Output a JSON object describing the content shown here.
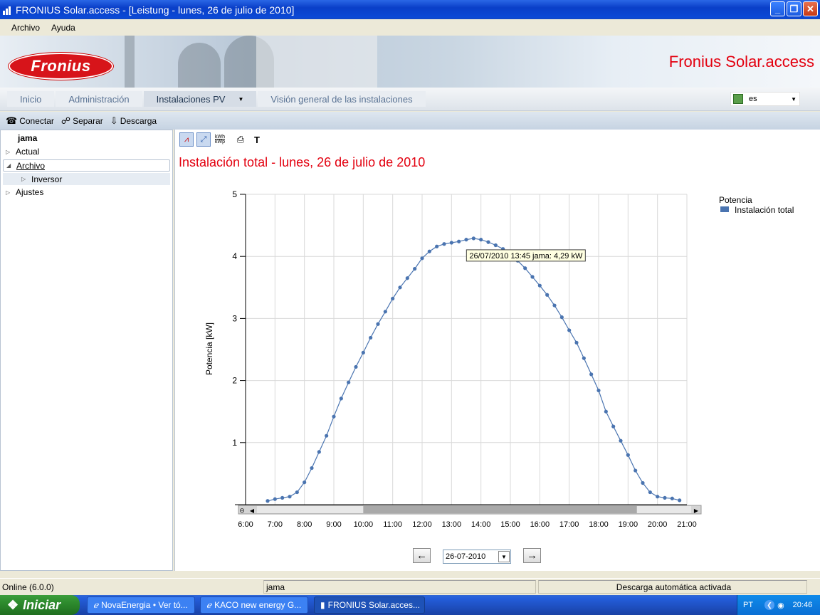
{
  "window": {
    "title": "FRONIUS Solar.access - [Leistung - lunes, 26 de julio de 2010]"
  },
  "menu": {
    "items": [
      "Archivo",
      "Ayuda"
    ]
  },
  "banner": {
    "logo_text": "Fronius",
    "app_title": "Fronius Solar.access"
  },
  "nav": {
    "tabs": [
      "Inicio",
      "Administración",
      "Instalaciones PV",
      "Visión general de las instalaciones"
    ],
    "language": "es"
  },
  "toolbar": {
    "connect": "Conectar",
    "disconnect": "Separar",
    "download": "Descarga"
  },
  "tree": {
    "root": "jama",
    "items": [
      "Actual",
      "Archivo",
      "Inversor",
      "Ajustes"
    ]
  },
  "chart_toolbar": {
    "kwh_top": "kWh",
    "kwh_bottom": "kWp",
    "text_tool": "T"
  },
  "main": {
    "heading": "Instalación total - lunes, 26 de julio de 2010"
  },
  "chart_data": {
    "type": "line",
    "ylabel": "Potencia [kW]",
    "xlabel": "",
    "ylim": [
      0,
      5
    ],
    "yticks": [
      "1",
      "2",
      "3",
      "4",
      "5"
    ],
    "xticks": [
      "6:00",
      "7:00",
      "8:00",
      "9:00",
      "10:00",
      "11:00",
      "12:00",
      "13:00",
      "14:00",
      "15:00",
      "16:00",
      "17:00",
      "18:00",
      "19:00",
      "20:00",
      "21:00"
    ],
    "legend_title": "Potencia",
    "legend_position": "top-right",
    "series": [
      {
        "name": "Instalación total",
        "color": "#4A74B0",
        "x": [
          6.75,
          7.0,
          7.25,
          7.5,
          7.75,
          8.0,
          8.25,
          8.5,
          8.75,
          9.0,
          9.25,
          9.5,
          9.75,
          10.0,
          10.25,
          10.5,
          10.75,
          11.0,
          11.25,
          11.5,
          11.75,
          12.0,
          12.25,
          12.5,
          12.75,
          13.0,
          13.25,
          13.5,
          13.75,
          14.0,
          14.25,
          14.5,
          14.75,
          15.0,
          15.25,
          15.5,
          15.75,
          16.0,
          16.25,
          16.5,
          16.75,
          17.0,
          17.25,
          17.5,
          17.75,
          18.0,
          18.25,
          18.5,
          18.75,
          19.0,
          19.25,
          19.5,
          19.75,
          20.0,
          20.25,
          20.5,
          20.75
        ],
        "y": [
          0.06,
          0.09,
          0.11,
          0.13,
          0.2,
          0.36,
          0.59,
          0.85,
          1.11,
          1.42,
          1.71,
          1.97,
          2.22,
          2.45,
          2.69,
          2.91,
          3.11,
          3.32,
          3.5,
          3.65,
          3.8,
          3.97,
          4.08,
          4.16,
          4.2,
          4.22,
          4.24,
          4.27,
          4.29,
          4.27,
          4.23,
          4.18,
          4.12,
          4.04,
          3.93,
          3.81,
          3.67,
          3.53,
          3.38,
          3.21,
          3.02,
          2.81,
          2.61,
          2.36,
          2.1,
          1.84,
          1.5,
          1.26,
          1.03,
          0.8,
          0.55,
          0.35,
          0.2,
          0.13,
          0.11,
          0.1,
          0.07
        ]
      }
    ],
    "tooltip": "26/07/2010 13:45 jama: 4,29 kW"
  },
  "date_nav": {
    "date": "26-07-2010"
  },
  "status": {
    "version": "Online (6.0.0)",
    "plant": "jama",
    "message": "Descarga automática activada"
  },
  "taskbar": {
    "start": "Iniciar",
    "tasks": [
      "NovaEnergia • Ver tó...",
      "KACO new energy G...",
      "FRONIUS Solar.acces..."
    ],
    "lang": "PT",
    "clock": "20:46"
  }
}
